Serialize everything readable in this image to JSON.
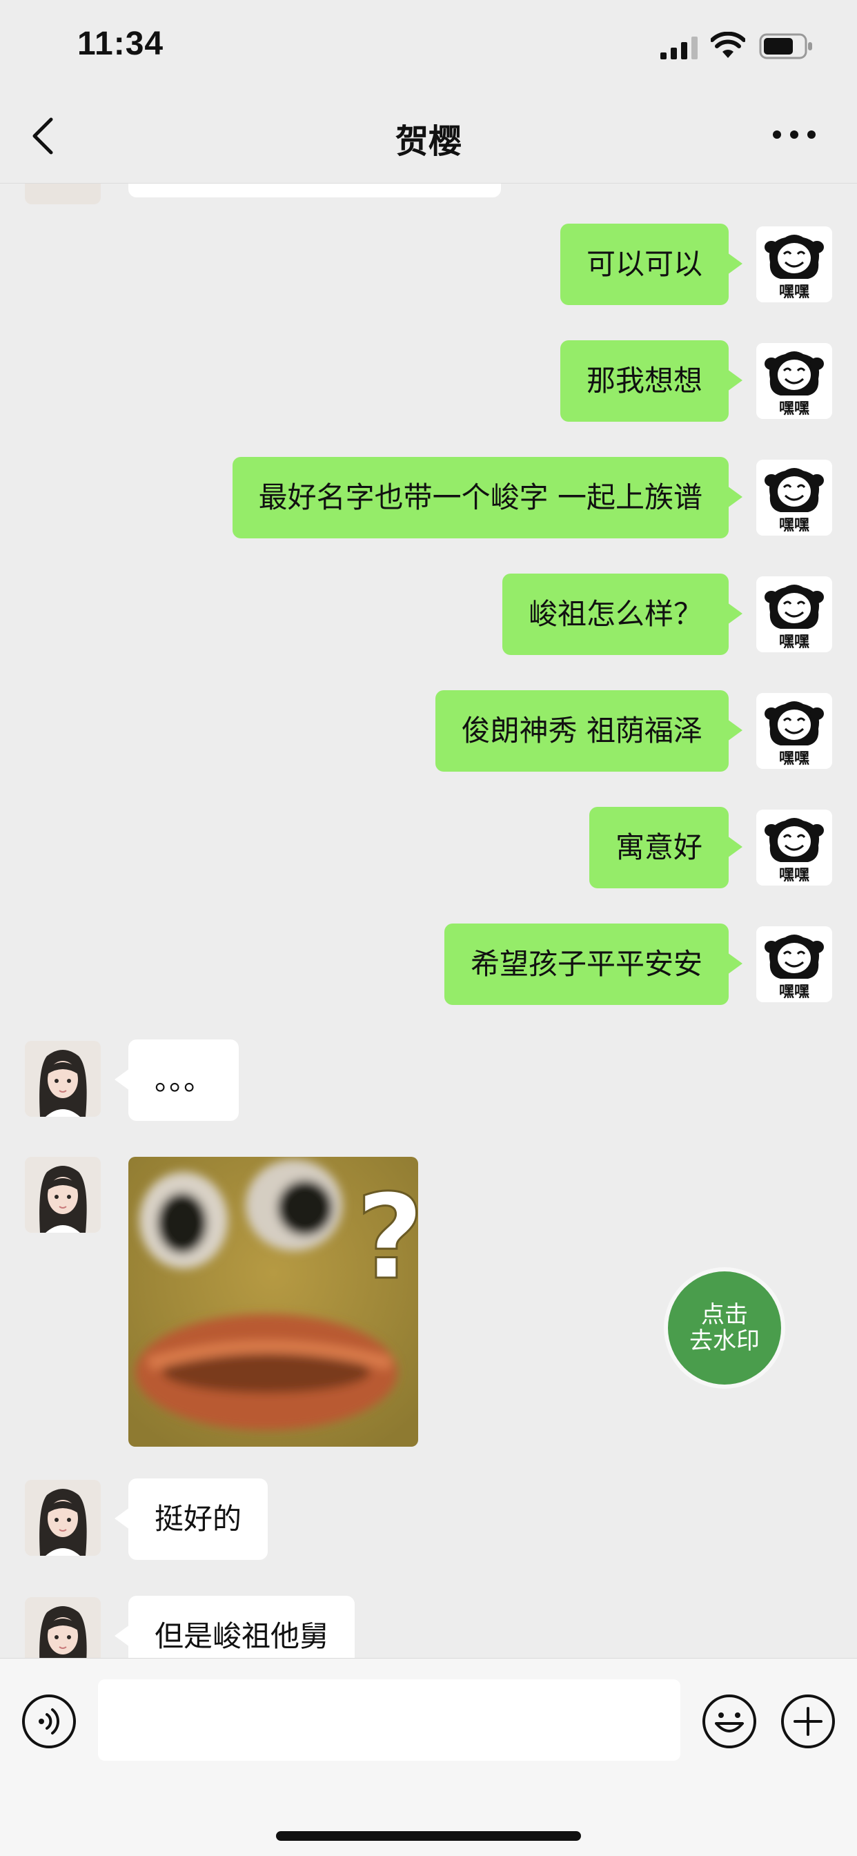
{
  "status_bar": {
    "time": "11:34",
    "battery_level": 0.75
  },
  "nav": {
    "title": "贺樱"
  },
  "sticker_labels": {
    "me_avatar_caption": "嘿嘿"
  },
  "messages_me": [
    "可以可以",
    "那我想想",
    "最好名字也带一个峻字 一起上族谱",
    "峻祖怎么样？",
    "俊朗神秀 祖荫福泽",
    "寓意好",
    "希望孩子平平安安"
  ],
  "messages_her": {
    "dots": "。。。",
    "good": "挺好的",
    "but": "但是峻祖他舅"
  },
  "watermark_button": {
    "line1": "点击",
    "line2": "去水印"
  },
  "input": {
    "placeholder": ""
  },
  "colors": {
    "bubble_me": "#95ec69",
    "bubble_her": "#ffffff",
    "background": "#ededed",
    "watermark_button": "#4a9d4c"
  }
}
